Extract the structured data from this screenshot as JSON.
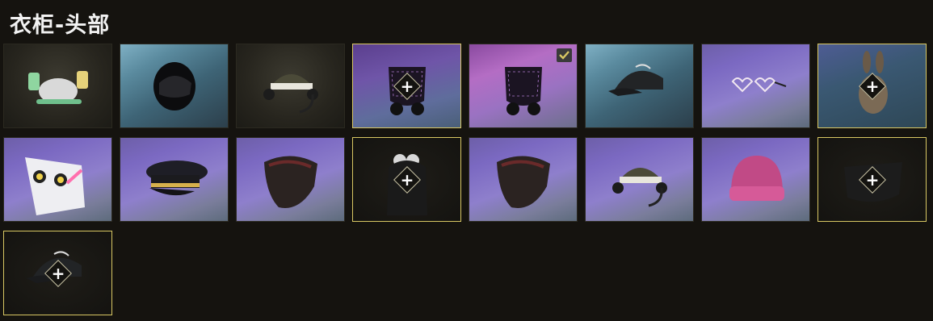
{
  "title": "衣柜-头部",
  "plus_symbol": "+",
  "accent_color": "#d8c763",
  "items": [
    {
      "name": "cell-helmet-cans",
      "icon": "drink-helmet-icon",
      "bg": "bg-dark"
    },
    {
      "name": "cell-moto-helmet",
      "icon": "motorcycle-helmet-icon",
      "bg": "bg-blue"
    },
    {
      "name": "cell-military-cap-headset",
      "icon": "headset-cap-icon",
      "bg": "bg-dark"
    },
    {
      "name": "cell-gas-mask-dark",
      "icon": "gas-mask-icon",
      "bg": "bg-violetblue",
      "highlight": true,
      "plus": true
    },
    {
      "name": "cell-gas-mask-pink",
      "icon": "gas-mask-icon",
      "bg": "bg-pink",
      "checked": true
    },
    {
      "name": "cell-baseball-cap",
      "icon": "baseball-cap-icon",
      "bg": "bg-blue"
    },
    {
      "name": "cell-heart-glasses",
      "icon": "heart-glasses-icon",
      "bg": "bg-purple"
    },
    {
      "name": "cell-bunny-mask",
      "icon": "bunny-mask-icon",
      "bg": "bg-teal",
      "highlight": true,
      "plus": true
    },
    {
      "name": "cell-cyber-helmet",
      "icon": "cyber-helmet-icon",
      "bg": "bg-purple"
    },
    {
      "name": "cell-officer-cap",
      "icon": "officer-cap-icon",
      "bg": "bg-purple"
    },
    {
      "name": "cell-red-bandana",
      "icon": "bandana-icon",
      "bg": "bg-purple"
    },
    {
      "name": "cell-panda-hood",
      "icon": "panda-hood-icon",
      "bg": "bg-black",
      "highlight": true,
      "plus": true
    },
    {
      "name": "cell-camo-bandana",
      "icon": "bandana-icon",
      "bg": "bg-purple"
    },
    {
      "name": "cell-headset-cap",
      "icon": "headset-cap-icon",
      "bg": "bg-purple"
    },
    {
      "name": "cell-beanie",
      "icon": "beanie-icon",
      "bg": "bg-purple"
    },
    {
      "name": "cell-black-mask",
      "icon": "face-mask-icon",
      "bg": "bg-black",
      "highlight": true,
      "plus": true
    },
    {
      "name": "cell-black-cap",
      "icon": "baseball-cap-icon",
      "bg": "bg-black",
      "highlight": true,
      "plus": true
    }
  ]
}
